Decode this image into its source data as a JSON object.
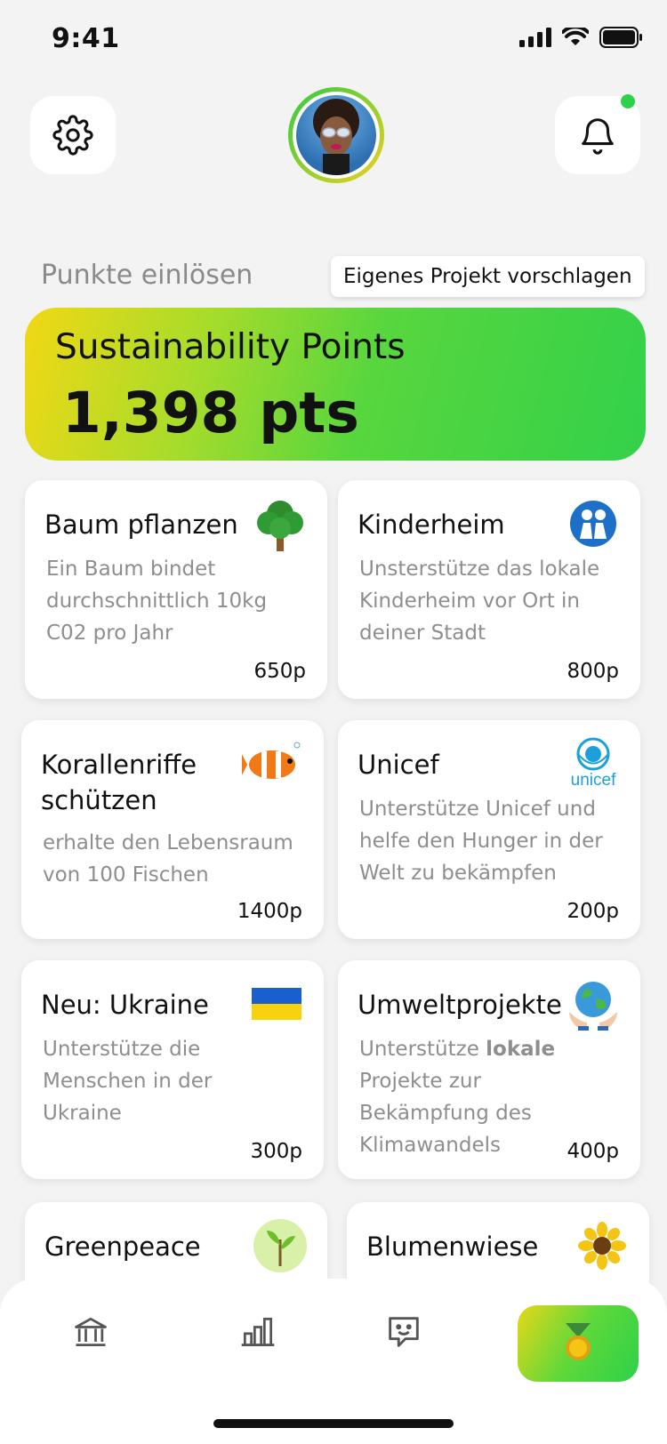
{
  "status": {
    "time": "9:41"
  },
  "header": {
    "settings_icon": "gear-icon",
    "bell_icon": "bell-icon",
    "avatar": "user-avatar"
  },
  "section": {
    "title": "Punkte einlösen",
    "propose_button": "Eigenes Projekt vorschlagen"
  },
  "points": {
    "label": "Sustainability Points",
    "value": "1,398 pts"
  },
  "projects": [
    {
      "title": "Baum pflanzen",
      "desc": "Ein Baum bindet durchschnittlich 10kg C02 pro Jahr",
      "points": "650p",
      "icon": "tree-icon"
    },
    {
      "title": "Kinderheim",
      "desc": "Unsterstütze das lokale Kinderheim vor Ort in deiner Stadt",
      "points": "800p",
      "icon": "children-icon"
    },
    {
      "title": "Korallenriffe schützen",
      "desc": "erhalte den Lebensraum von 100 Fischen",
      "points": "1400p",
      "icon": "clownfish-icon"
    },
    {
      "title": "Unicef",
      "desc": "Unterstütze Unicef und helfe den Hunger in der Welt zu bekämpfen",
      "points": "200p",
      "icon": "unicef-logo",
      "logo_text": "unicef"
    },
    {
      "title": "Neu: Ukraine",
      "desc": "Unterstütze die Menschen in der Ukraine",
      "points": "300p",
      "icon": "ukraine-flag-icon"
    },
    {
      "title": "Umweltprojekte",
      "desc_pre": "Unterstütze ",
      "desc_bold": "lokale",
      "desc_post": " Projekte zur Bekämpfung des Klimawandels",
      "points": "400p",
      "icon": "globe-hands-icon"
    },
    {
      "title": "Greenpeace",
      "icon": "sprout-icon"
    },
    {
      "title": "Blumenwiese",
      "icon": "sunflower-icon"
    }
  ],
  "nav": {
    "items": [
      "bank-icon",
      "chart-icon",
      "chat-icon",
      "medal-icon"
    ],
    "active": "medal-icon"
  },
  "colors": {
    "accent_green": "#2ed14a",
    "accent_yellow": "#f2d814",
    "background": "#f3f3f3"
  }
}
